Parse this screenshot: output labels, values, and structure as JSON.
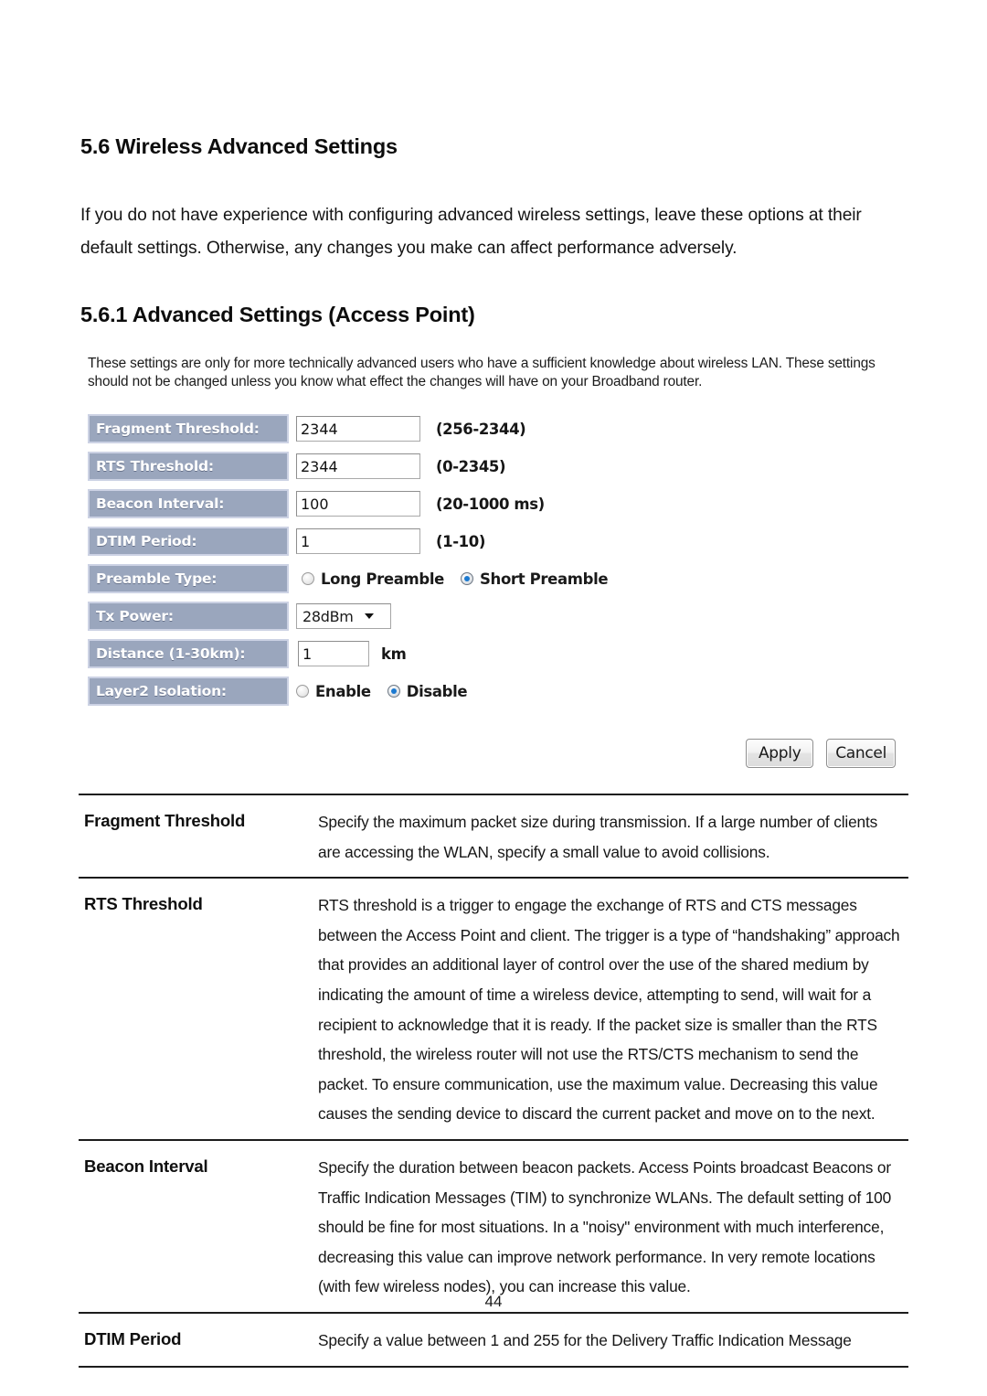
{
  "document": {
    "section_heading": "5.6 Wireless Advanced Settings",
    "intro_paragraph": "If you do not have experience with configuring advanced wireless settings, leave these options at their default settings. Otherwise, any changes you make can affect performance adversely.",
    "subsection_heading": "5.6.1 Advanced Settings (Access Point)",
    "page_number": "44"
  },
  "screenshot": {
    "note": "These settings are only for more technically advanced users who have a sufficient knowledge about wireless LAN. These settings should not be changed unless you know what effect the changes will have on your Broadband router.",
    "fields": {
      "fragment_threshold": {
        "label": "Fragment Threshold:",
        "value": "2344",
        "hint": "(256-2344)"
      },
      "rts_threshold": {
        "label": "RTS Threshold:",
        "value": "2344",
        "hint": "(0-2345)"
      },
      "beacon_interval": {
        "label": "Beacon Interval:",
        "value": "100",
        "hint": "(20-1000 ms)"
      },
      "dtim_period": {
        "label": "DTIM Period:",
        "value": "1",
        "hint": "(1-10)"
      },
      "preamble_type": {
        "label": "Preamble Type:",
        "option_long": "Long Preamble",
        "option_short": "Short Preamble",
        "selected": "Short Preamble"
      },
      "tx_power": {
        "label": "Tx Power:",
        "value": "28dBm"
      },
      "distance": {
        "label": "Distance (1-30km):",
        "value": "1",
        "unit": "km"
      },
      "layer2_isolation": {
        "label": "Layer2 Isolation:",
        "option_enable": "Enable",
        "option_disable": "Disable",
        "selected": "Disable"
      }
    },
    "buttons": {
      "apply": "Apply",
      "cancel": "Cancel"
    },
    "colors": {
      "label_background": "#9aa6bd",
      "label_border": "#ccd2e4",
      "label_text": "#ffffff",
      "radio_selected": "#1b79d0"
    }
  },
  "description_table": {
    "rows": [
      {
        "term": "Fragment Threshold",
        "description": "Specify the maximum packet size during transmission. If a large number of clients are accessing the WLAN, specify a small value to avoid collisions."
      },
      {
        "term": "RTS Threshold",
        "description": "RTS threshold is a trigger to engage the exchange of RTS and CTS messages between the Access Point and client. The trigger is a type of “handshaking” approach that provides an additional layer of control over the use of the shared medium by indicating the amount of time a wireless device, attempting to send, will wait for a recipient to acknowledge that it is ready. If the packet size is smaller than the RTS threshold, the wireless router will not use the RTS/CTS mechanism to send the packet. To ensure communication, use the maximum value. Decreasing this value causes the sending device to discard the current packet and move on to the next."
      },
      {
        "term": "Beacon Interval",
        "description": "Specify the duration between beacon packets. Access Points broadcast Beacons or Traffic Indication Messages (TIM) to synchronize WLANs. The default setting of 100 should be fine for most situations. In a \"noisy\" environment with much interference, decreasing this value can improve network performance. In very remote locations (with few wireless nodes), you can increase this value."
      },
      {
        "term": "DTIM Period",
        "description": "Specify a value between 1 and 255 for the Delivery Traffic Indication Message"
      }
    ]
  }
}
